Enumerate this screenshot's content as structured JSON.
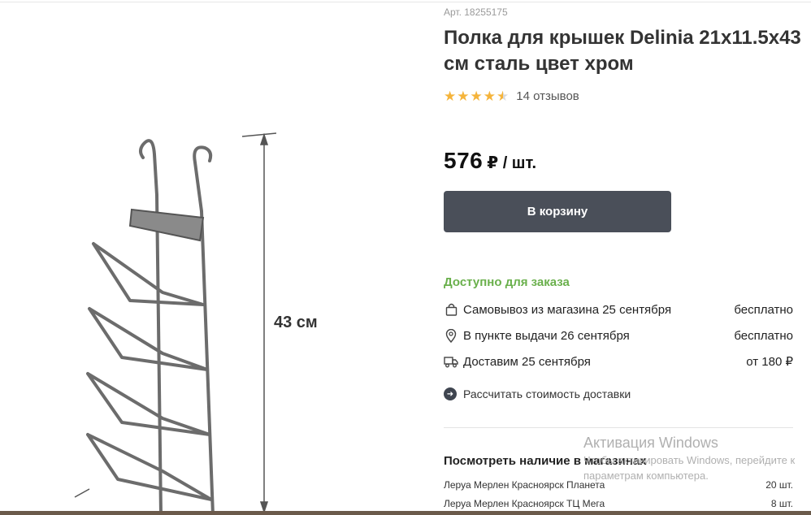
{
  "product": {
    "sku": "Арт. 18255175",
    "title": "Полка для крышек Delinia 21x11.5x43 см сталь цвет хром",
    "rating": 4.5,
    "reviews": "14 отзывов",
    "price_value": "576",
    "price_unit": "₽ / шт.",
    "image": {
      "dimension_label": "43 см"
    }
  },
  "cart": {
    "button_label": "В корзину"
  },
  "availability": {
    "status": "Доступно для заказа",
    "options": [
      {
        "icon": "lock-bag-icon",
        "label": "Самовывоз из магазина 25 сентября",
        "cost": "бесплатно"
      },
      {
        "icon": "location-pin-icon",
        "label": "В пункте выдачи 26 сентября",
        "cost": "бесплатно"
      },
      {
        "icon": "truck-icon",
        "label": "Доставим 25 сентября",
        "cost": "от 180 ₽"
      }
    ],
    "calc_link": "Рассчитать стоимость доставки"
  },
  "stores": {
    "title": "Посмотреть наличие в магазинах",
    "items": [
      {
        "name": "Леруа Мерлен Красноярск Планета",
        "qty": "20 шт."
      },
      {
        "name": "Леруа Мерлен Красноярск ТЦ Мега",
        "qty": "8 шт."
      }
    ]
  },
  "watermark": {
    "title": "Активация Windows",
    "line1": "Чтобы активировать Windows, перейдите к",
    "line2": "параметрам компьютера."
  },
  "colors": {
    "accent_green": "#6ab04c",
    "button_bg": "#4a4f59",
    "star": "#f5b43b"
  }
}
